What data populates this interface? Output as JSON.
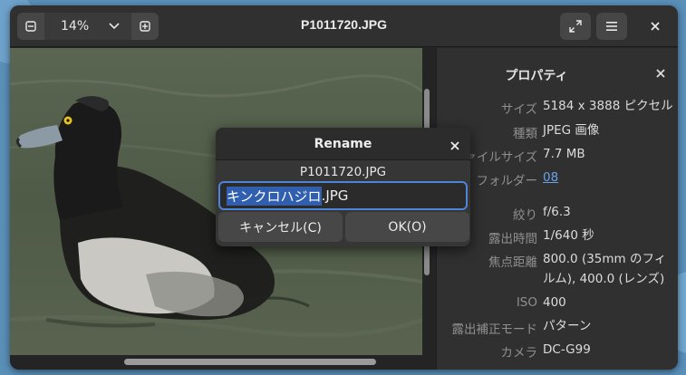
{
  "window": {
    "title": "P1011720.JPG"
  },
  "toolbar": {
    "zoom_value": "14%",
    "fullscreen_icon": "fullscreen-icon",
    "menu_icon": "hamburger-menu-icon",
    "close_icon": "close-icon"
  },
  "properties": {
    "title": "プロパティ",
    "rows": [
      {
        "key": "サイズ",
        "value": "5184 x 3888 ピクセル"
      },
      {
        "key": "種類",
        "value": "JPEG 画像"
      },
      {
        "key": "ファイルサイズ",
        "value": "7.7 MB"
      },
      {
        "key": "フォルダー",
        "value": "08"
      },
      {
        "key": "絞り",
        "value": "f/6.3"
      },
      {
        "key": "露出時間",
        "value": "1/640 秒"
      },
      {
        "key": "焦点距離",
        "value": "800.0 (35mm のフィルム), 400.0 (レンズ)"
      },
      {
        "key": "ISO",
        "value": "400"
      },
      {
        "key": "露出補正モード",
        "value": "パターン"
      },
      {
        "key": "カメラ",
        "value": "DC-G99"
      }
    ]
  },
  "dialog": {
    "title": "Rename",
    "original_name": "P1011720.JPG",
    "input_selected": "キンクロハジロ",
    "input_rest": ".JPG",
    "cancel_label": "キャンセル(C)",
    "ok_label": "OK(O)"
  },
  "colors": {
    "accent": "#4b86d8",
    "link": "#6aa2e8",
    "background": "#242424"
  }
}
